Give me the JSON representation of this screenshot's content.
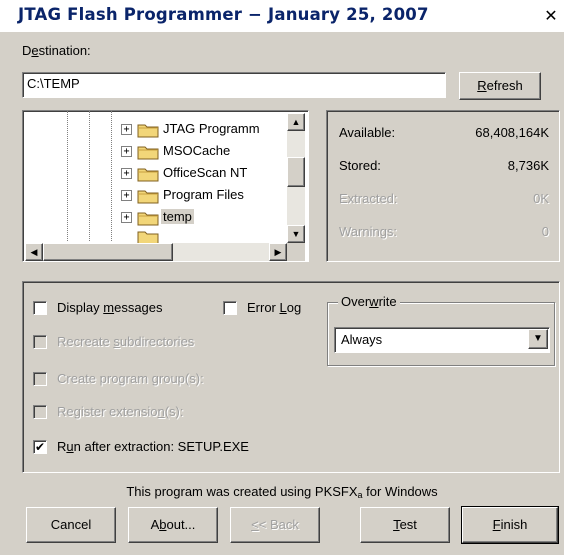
{
  "window": {
    "title": "JTAG Flash Programmer − January 25, 2007",
    "close_label": "✕"
  },
  "destination": {
    "label_accel": "e",
    "label_pre": "D",
    "label_post": "stination:",
    "value": "C:\\TEMP",
    "refresh_accel": "R",
    "refresh_rest": "efresh"
  },
  "tree": {
    "items": [
      {
        "label": "JTAG Programm",
        "selected": false
      },
      {
        "label": "MSOCache",
        "selected": false
      },
      {
        "label": "OfficeScan NT",
        "selected": false
      },
      {
        "label": "Program Files",
        "selected": false
      },
      {
        "label": "temp",
        "selected": true
      }
    ],
    "expand_glyph": "+",
    "up_arrow": "▲",
    "down_arrow": "▼",
    "left_arrow": "◀",
    "right_arrow": "▶"
  },
  "stats": {
    "available": {
      "label": "Available:",
      "value": "68,408,164K"
    },
    "stored": {
      "label": "Stored:",
      "value": "8,736K"
    },
    "extracted": {
      "label": "Extracted:",
      "value": "0K"
    },
    "warnings": {
      "label": "Warnings:",
      "value": "0"
    }
  },
  "options": {
    "display_messages": {
      "pre": "Display ",
      "accel": "m",
      "post": "essages",
      "checked": false,
      "enabled": true
    },
    "error_log": {
      "pre": "Error ",
      "accel": "L",
      "post": "og",
      "checked": false,
      "enabled": true
    },
    "recreate_subdirs": {
      "pre": "Recreate ",
      "accel": "s",
      "post": "ubdirectories",
      "checked": false,
      "enabled": false
    },
    "create_program_group": {
      "pre": "Create program ",
      "accel": "g",
      "post": "roup(s):",
      "checked": false,
      "enabled": false
    },
    "register_extensions": {
      "pre": "Register extensio",
      "accel": "n",
      "post": "(s):",
      "checked": false,
      "enabled": false
    },
    "run_after": {
      "pre": "R",
      "accel": "u",
      "post": "n after extraction: SETUP.EXE",
      "checked": true,
      "enabled": true
    },
    "check_glyph": "✔"
  },
  "overwrite": {
    "legend_pre": "Over",
    "legend_accel": "w",
    "legend_post": "rite",
    "value": "Always",
    "arrow": "▼"
  },
  "footer": {
    "credit_pre": "This program was created using PKSFX",
    "credit_sub": "a",
    "credit_post": " for Windows"
  },
  "buttons": {
    "cancel": "Cancel",
    "about_pre": "A",
    "about_accel": "b",
    "about_post": "out...",
    "back_accel": "<",
    "back_post": "< Back",
    "test_accel": "T",
    "test_post": "est",
    "finish_accel": "F",
    "finish_post": "inish"
  },
  "colors": {
    "face": "#d4d0c8",
    "title_text": "#0a246a",
    "folder": "#f2d679",
    "disabled_text": "#a0a0a0"
  }
}
